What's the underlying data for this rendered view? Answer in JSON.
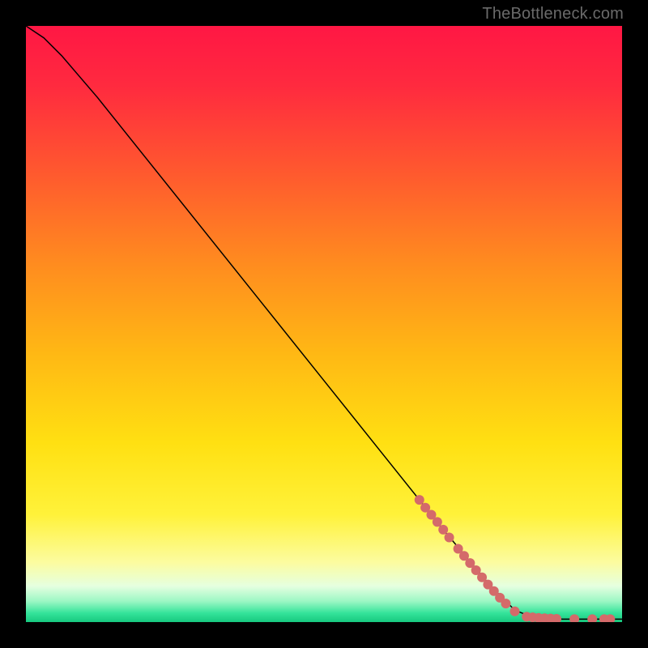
{
  "watermark": "TheBottleneck.com",
  "chart_data": {
    "type": "line",
    "title": "",
    "xlabel": "",
    "ylabel": "",
    "xlim": [
      0,
      100
    ],
    "ylim": [
      0,
      100
    ],
    "grid": false,
    "legend": false,
    "background": "vertical-gradient",
    "gradient_stops": [
      {
        "pos": 0.0,
        "color": "#ff1744"
      },
      {
        "pos": 0.1,
        "color": "#ff2a3f"
      },
      {
        "pos": 0.25,
        "color": "#ff5a2e"
      },
      {
        "pos": 0.4,
        "color": "#ff8c1f"
      },
      {
        "pos": 0.55,
        "color": "#ffb814"
      },
      {
        "pos": 0.7,
        "color": "#ffe012"
      },
      {
        "pos": 0.82,
        "color": "#fff23a"
      },
      {
        "pos": 0.9,
        "color": "#fcfca0"
      },
      {
        "pos": 0.94,
        "color": "#e5ffe0"
      },
      {
        "pos": 0.965,
        "color": "#9cf7c4"
      },
      {
        "pos": 0.985,
        "color": "#34e39a"
      },
      {
        "pos": 1.0,
        "color": "#17c97f"
      }
    ],
    "series": [
      {
        "name": "bottleneck-curve",
        "color": "#000000",
        "points": [
          {
            "x": 0,
            "y": 100
          },
          {
            "x": 3,
            "y": 98
          },
          {
            "x": 6,
            "y": 95
          },
          {
            "x": 9,
            "y": 91.5
          },
          {
            "x": 12,
            "y": 88
          },
          {
            "x": 20,
            "y": 78
          },
          {
            "x": 30,
            "y": 65.5
          },
          {
            "x": 40,
            "y": 53
          },
          {
            "x": 50,
            "y": 40.5
          },
          {
            "x": 60,
            "y": 28
          },
          {
            "x": 70,
            "y": 15.5
          },
          {
            "x": 78,
            "y": 6
          },
          {
            "x": 82,
            "y": 2
          },
          {
            "x": 85,
            "y": 0.8
          },
          {
            "x": 90,
            "y": 0.5
          },
          {
            "x": 100,
            "y": 0.5
          }
        ]
      }
    ],
    "markers": {
      "name": "highlighted-points",
      "color": "#d46a6a",
      "radius_px": 6,
      "points": [
        {
          "x": 66,
          "y": 20.5
        },
        {
          "x": 67,
          "y": 19.2
        },
        {
          "x": 68,
          "y": 18.0
        },
        {
          "x": 69,
          "y": 16.8
        },
        {
          "x": 70,
          "y": 15.5
        },
        {
          "x": 71,
          "y": 14.2
        },
        {
          "x": 72.5,
          "y": 12.3
        },
        {
          "x": 73.5,
          "y": 11.1
        },
        {
          "x": 74.5,
          "y": 9.9
        },
        {
          "x": 75.5,
          "y": 8.7
        },
        {
          "x": 76.5,
          "y": 7.5
        },
        {
          "x": 77.5,
          "y": 6.3
        },
        {
          "x": 78.5,
          "y": 5.2
        },
        {
          "x": 79.5,
          "y": 4.1
        },
        {
          "x": 80.5,
          "y": 3.1
        },
        {
          "x": 82,
          "y": 1.8
        },
        {
          "x": 84,
          "y": 0.9
        },
        {
          "x": 85,
          "y": 0.8
        },
        {
          "x": 86,
          "y": 0.7
        },
        {
          "x": 87,
          "y": 0.65
        },
        {
          "x": 88,
          "y": 0.6
        },
        {
          "x": 89,
          "y": 0.55
        },
        {
          "x": 92,
          "y": 0.5
        },
        {
          "x": 95,
          "y": 0.5
        },
        {
          "x": 97,
          "y": 0.5
        },
        {
          "x": 98,
          "y": 0.5
        }
      ]
    }
  }
}
